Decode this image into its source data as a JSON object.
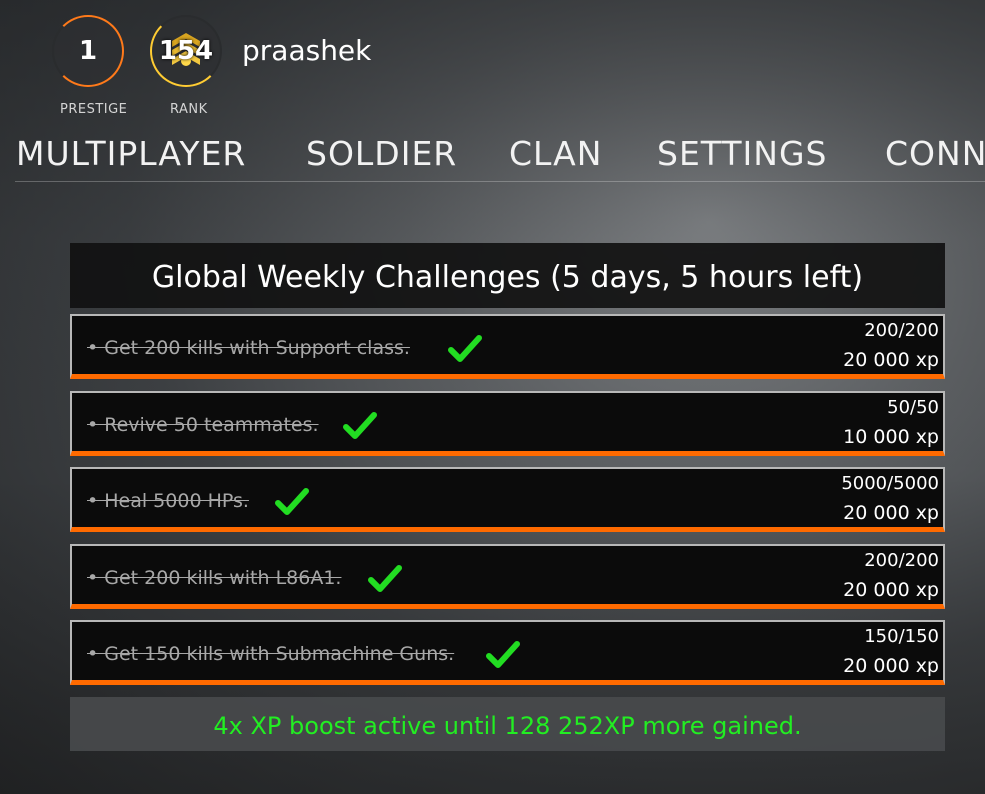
{
  "profile": {
    "prestige_value": "1",
    "prestige_label": "PRESTIGE",
    "rank_value": "154",
    "rank_label": "RANK",
    "username": "praashek"
  },
  "nav": {
    "items": [
      "MULTIPLAYER",
      "SOLDIER",
      "CLAN",
      "SETTINGS",
      "CONN"
    ]
  },
  "challenges": {
    "title": "Global Weekly Challenges (5 days, 5 hours left)",
    "items": [
      {
        "text": "• Get 200 kills with Support class.",
        "progress": "200/200",
        "xp": "20 000 xp",
        "completed": true
      },
      {
        "text": "• Revive 50 teammates.",
        "progress": "50/50",
        "xp": "10 000 xp",
        "completed": true
      },
      {
        "text": "• Heal 5000 HPs.",
        "progress": "5000/5000",
        "xp": "20 000 xp",
        "completed": true
      },
      {
        "text": "• Get 200 kills with L86A1.",
        "progress": "200/200",
        "xp": "20 000 xp",
        "completed": true
      },
      {
        "text": "• Get 150 kills with Submachine Guns.",
        "progress": "150/150",
        "xp": "20 000 xp",
        "completed": true
      }
    ],
    "boost_text": "4x XP boost active until 128 252XP more gained."
  },
  "colors": {
    "accent_orange": "#ff6a00",
    "check_green": "#22dd22",
    "boost_green": "#22ee22",
    "rank_gold": "#ffcc33"
  },
  "icons": {
    "check": "check-icon",
    "rank_insignia": "rank-insignia-icon"
  }
}
